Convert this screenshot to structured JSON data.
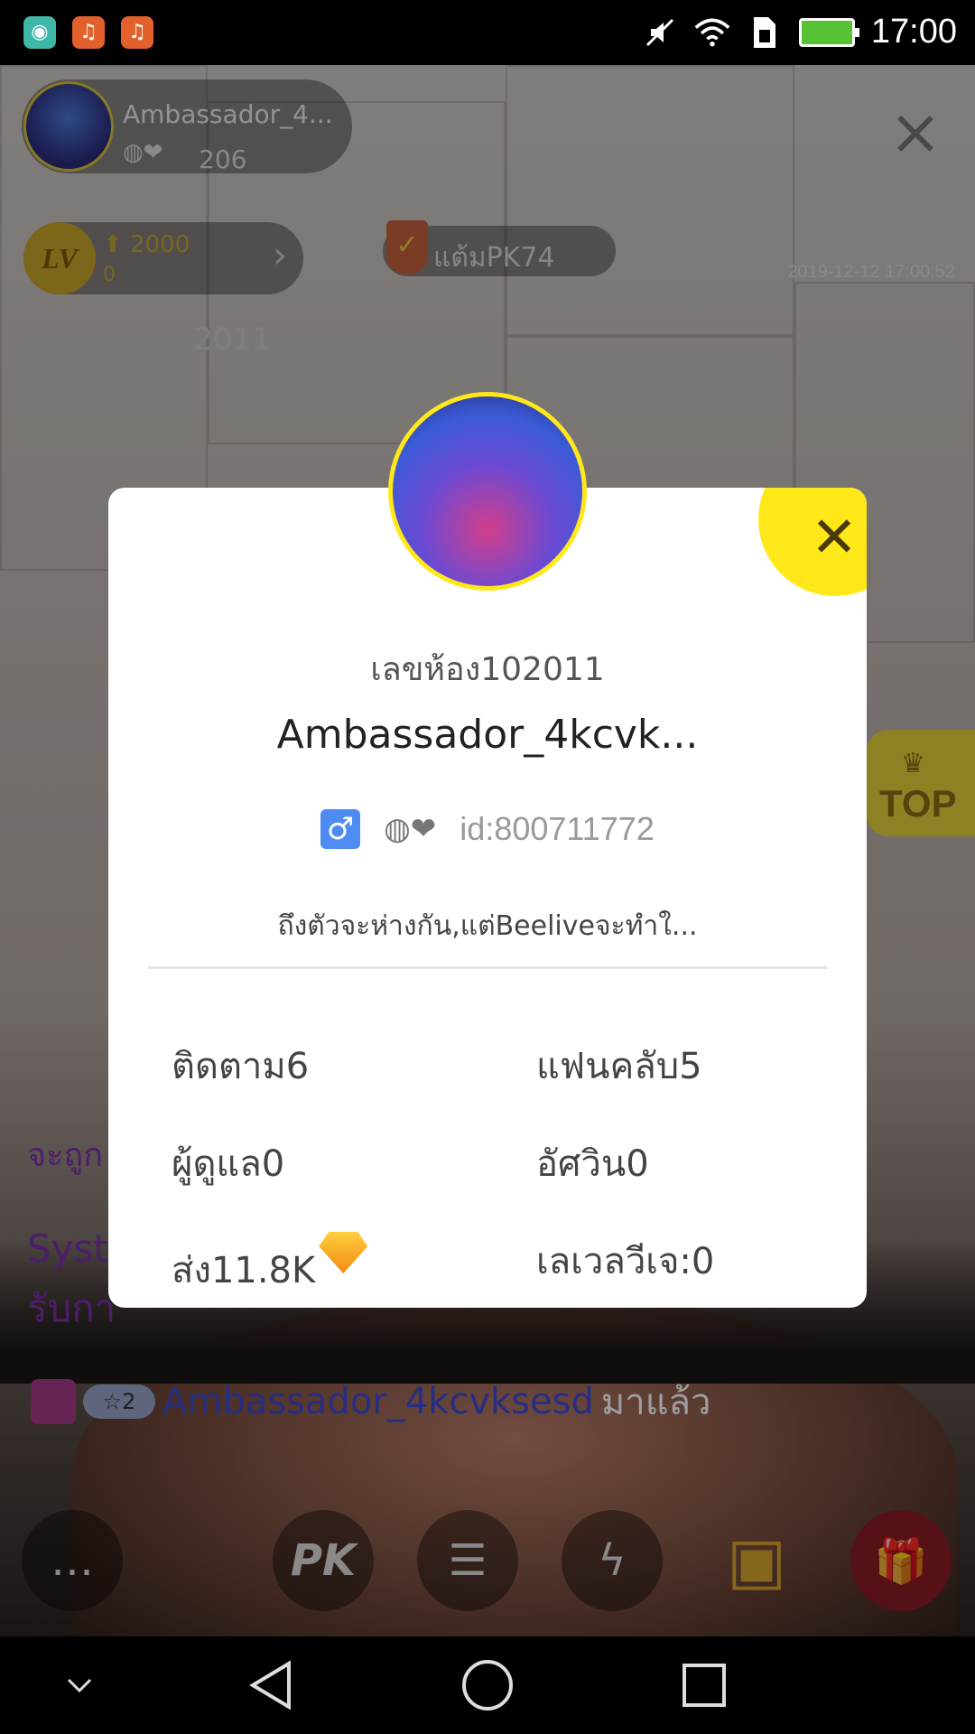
{
  "status_bar": {
    "time": "17:00",
    "icons": [
      "android-icon",
      "music-icon",
      "music-icon",
      "mute-icon",
      "wifi-icon",
      "sim-icon",
      "battery-charging-icon"
    ]
  },
  "live": {
    "host": {
      "name": "Ambassador_4...",
      "viewers": "206"
    },
    "level": {
      "badge": "LV",
      "value": "2000",
      "sub": "0"
    },
    "pk_points": "แต้มPK74",
    "timestamp": "2019-12-12 17:00:52",
    "faint_id": "2011",
    "top_button": "TOP",
    "chat": {
      "line1": "จะถูก",
      "line2a": "Syst",
      "line2b": "รับกา",
      "entry_badge": "☆2",
      "entry_name": "Ambassador_4kcvksesd",
      "entry_suffix": "มาแล้ว"
    },
    "toolbar": {
      "pk_label": "PK"
    }
  },
  "profile_card": {
    "room_number": "เลขห้อง102011",
    "name": "Ambassador_4kcvk...",
    "gender_symbol": "♂",
    "user_id": "id:800711772",
    "bio": "ถึงตัวจะห่างกัน,แต่Beeliveจะทำใ...",
    "stats": {
      "following": "ติดตาม6",
      "fans": "แฟนคลับ5",
      "admins": "ผู้ดูแล0",
      "knights": "อัศวิน0",
      "sent": "ส่ง11.8K",
      "vj_level": "เลเวลวีเจ:0"
    }
  },
  "colors": {
    "accent_yellow": "#ffe81a",
    "chat_purple": "#7b2fa8",
    "name_blue": "#3e4bd4",
    "gender_blue": "#4e8bf2"
  }
}
